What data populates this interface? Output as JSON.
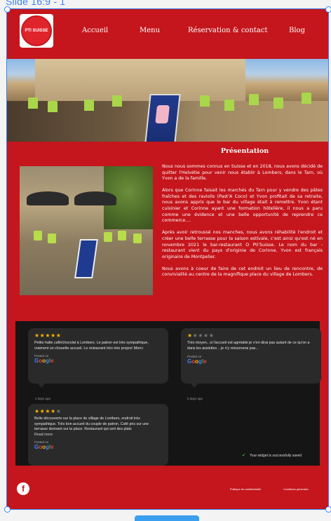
{
  "editor": {
    "slide_label": "Slide 16:9 - 1"
  },
  "colors": {
    "brand_red": "#c4161c",
    "selection_blue": "#3b82f6",
    "review_bg": "#151515",
    "star_gold": "#f5b400"
  },
  "header": {
    "logo_text": "PTI SUISSE",
    "nav": [
      "Accueil",
      "Menu",
      "Réservation & contact",
      "Blog"
    ]
  },
  "presentation": {
    "title": "Présentation",
    "paragraphs": [
      "Nous nous sommes connus en Suisse et en 2018, nous avons décidé de quitter l'Helvétie pour venir nous établir à Lombers, dans le Tarn, où Yvon a de la famille.",
      "Alors que Corinne faisait les marchés du Tarn pour y vendre des pâtes fraîches et des raviolis (Past'A Coco) et Yvon profitait de sa retraite, nous avons appris que le bar du village était à remettre. Yvon étant cuisinier et Corinne ayant une formation hôtelière, il nous a paru comme une évidence et une belle opportunité de reprendre ce commerce....",
      "Après avoir retroussé nos manches, nous avons réhabilité l'endroit et créer une belle terrasse pour la saison estivale, c'est ainsi qu'est né en novembre 2021 le bar-restaurant O Pti'Suisse. Le nom du bar -restaurant vient du pays d'originie de Corinne, Yvon est français originaire de Montpelier.",
      "Nous avons à coeur de faire de cet endroit un lieu de rencontre, de convivialité au centre de la magnifique place du village de Lombers."
    ]
  },
  "reviews": [
    {
      "stars": 5,
      "text": "Petite halte café/chocolat à Lombers. Le patron est très sympathique, vraiment un chouette accueil. Le restaurant très très propre! Merci",
      "posted_on": "Posted on",
      "source": "Google",
      "date": "2 days ago"
    },
    {
      "stars": 1,
      "text": "Très moyen.. si l'accueil est agréable je n'en dirai pas autant de ce qu'on a dans les assiettes .. je n'y retournerai pas...",
      "posted_on": "Posted on",
      "source": "Google",
      "date": "5 days ago"
    },
    {
      "stars": 4,
      "text": "Belle découverte sur la place du village de Lombers, endroit très sympathique. Très bon accueil du couple de patron. Café pris sur une terrasse donnant sur la place. Restaurant qui sert des plats",
      "read_more": "Read more",
      "posted_on": "Posted on",
      "source": "Google",
      "date": ""
    }
  ],
  "widget_status": "Your widget is successfully saved",
  "footer": {
    "facebook_icon": "f",
    "privacy_link": "Politique de confidentialité",
    "terms_link": "Conditions générales"
  }
}
